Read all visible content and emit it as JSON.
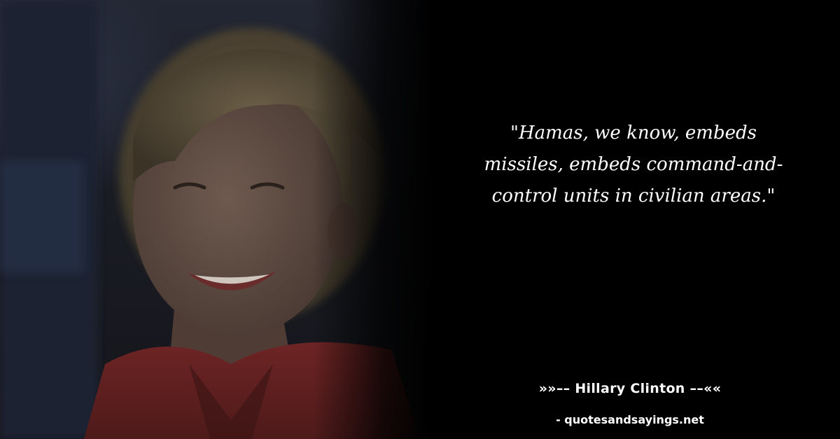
{
  "quote": {
    "text": "\"Hamas, we know, embeds missiles, embeds command-and-control units in civilian areas.\""
  },
  "author": {
    "label": "»»–– Hillary Clinton ––««"
  },
  "source": {
    "label": "- quotesandsayings.net"
  },
  "colors": {
    "background": "#000000",
    "text": "#ffffff",
    "jacket": "#8a2a2a"
  }
}
